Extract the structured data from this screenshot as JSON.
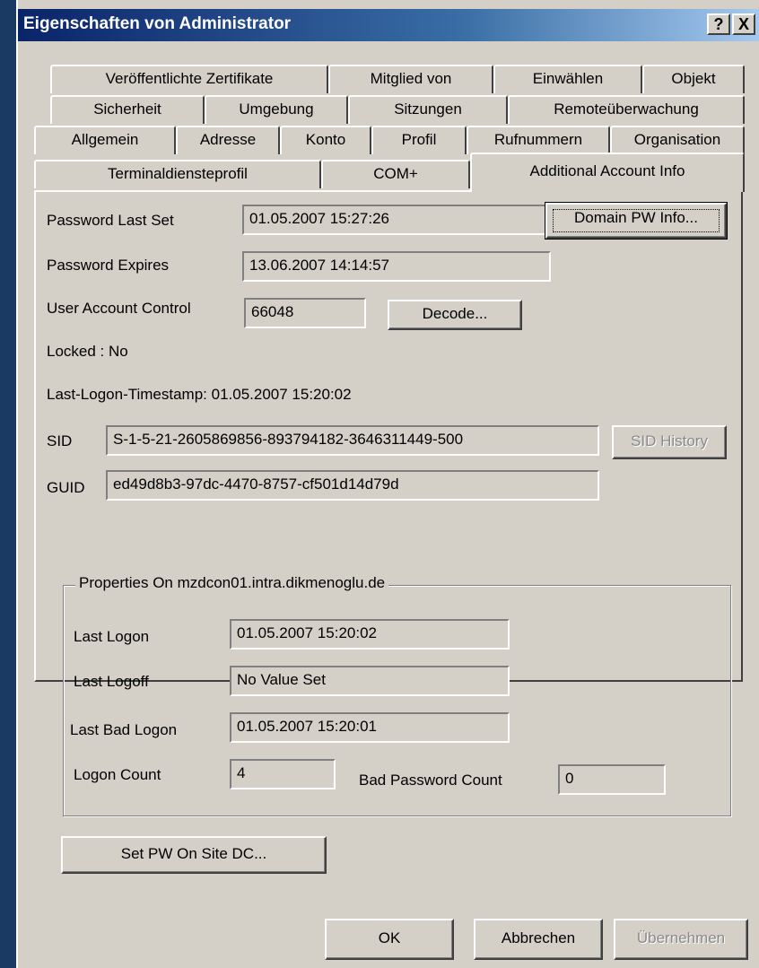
{
  "window": {
    "title": "Eigenschaften von Administrator",
    "help_button": "?",
    "close_button": "X"
  },
  "tabs": {
    "row1": [
      "Veröffentlichte Zertifikate",
      "Mitglied von",
      "Einwählen",
      "Objekt"
    ],
    "row2": [
      "Sicherheit",
      "Umgebung",
      "Sitzungen",
      "Remoteüberwachung"
    ],
    "row3": [
      "Allgemein",
      "Adresse",
      "Konto",
      "Profil",
      "Rufnummern",
      "Organisation"
    ],
    "row4": [
      "Terminaldiensteprofil",
      "COM+",
      "Additional Account Info"
    ],
    "active": "Additional Account Info"
  },
  "account": {
    "password_last_set_label": "Password Last Set",
    "password_last_set": "01.05.2007 15:27:26",
    "domain_pw_info_button": "Domain PW Info...",
    "password_expires_label": "Password Expires",
    "password_expires": "13.06.2007 14:14:57",
    "uac_label": "User Account Control",
    "uac_value": "66048",
    "decode_button": "Decode...",
    "locked_text": "Locked : No",
    "last_logon_timestamp_text": "Last-Logon-Timestamp: 01.05.2007 15:20:02",
    "sid_label": "SID",
    "sid_value": "S-1-5-21-2605869856-893794182-3646311449-500",
    "sid_history_button": "SID History",
    "guid_label": "GUID",
    "guid_value": "ed49d8b3-97dc-4470-8757-cf501d14d79d"
  },
  "properties": {
    "group_title": "Properties On mzdcon01.intra.dikmenoglu.de",
    "last_logon_label": "Last Logon",
    "last_logon": "01.05.2007 15:20:02",
    "last_logoff_label": "Last Logoff",
    "last_logoff": "No Value Set",
    "last_bad_logon_label": "Last Bad Logon",
    "last_bad_logon": "01.05.2007 15:20:01",
    "logon_count_label": "Logon Count",
    "logon_count": "4",
    "bad_password_count_label": "Bad Password Count",
    "bad_password_count": "0"
  },
  "buttons": {
    "set_pw_on_site_dc": "Set PW On Site DC...",
    "ok": "OK",
    "cancel": "Abbrechen",
    "apply": "Übernehmen"
  }
}
